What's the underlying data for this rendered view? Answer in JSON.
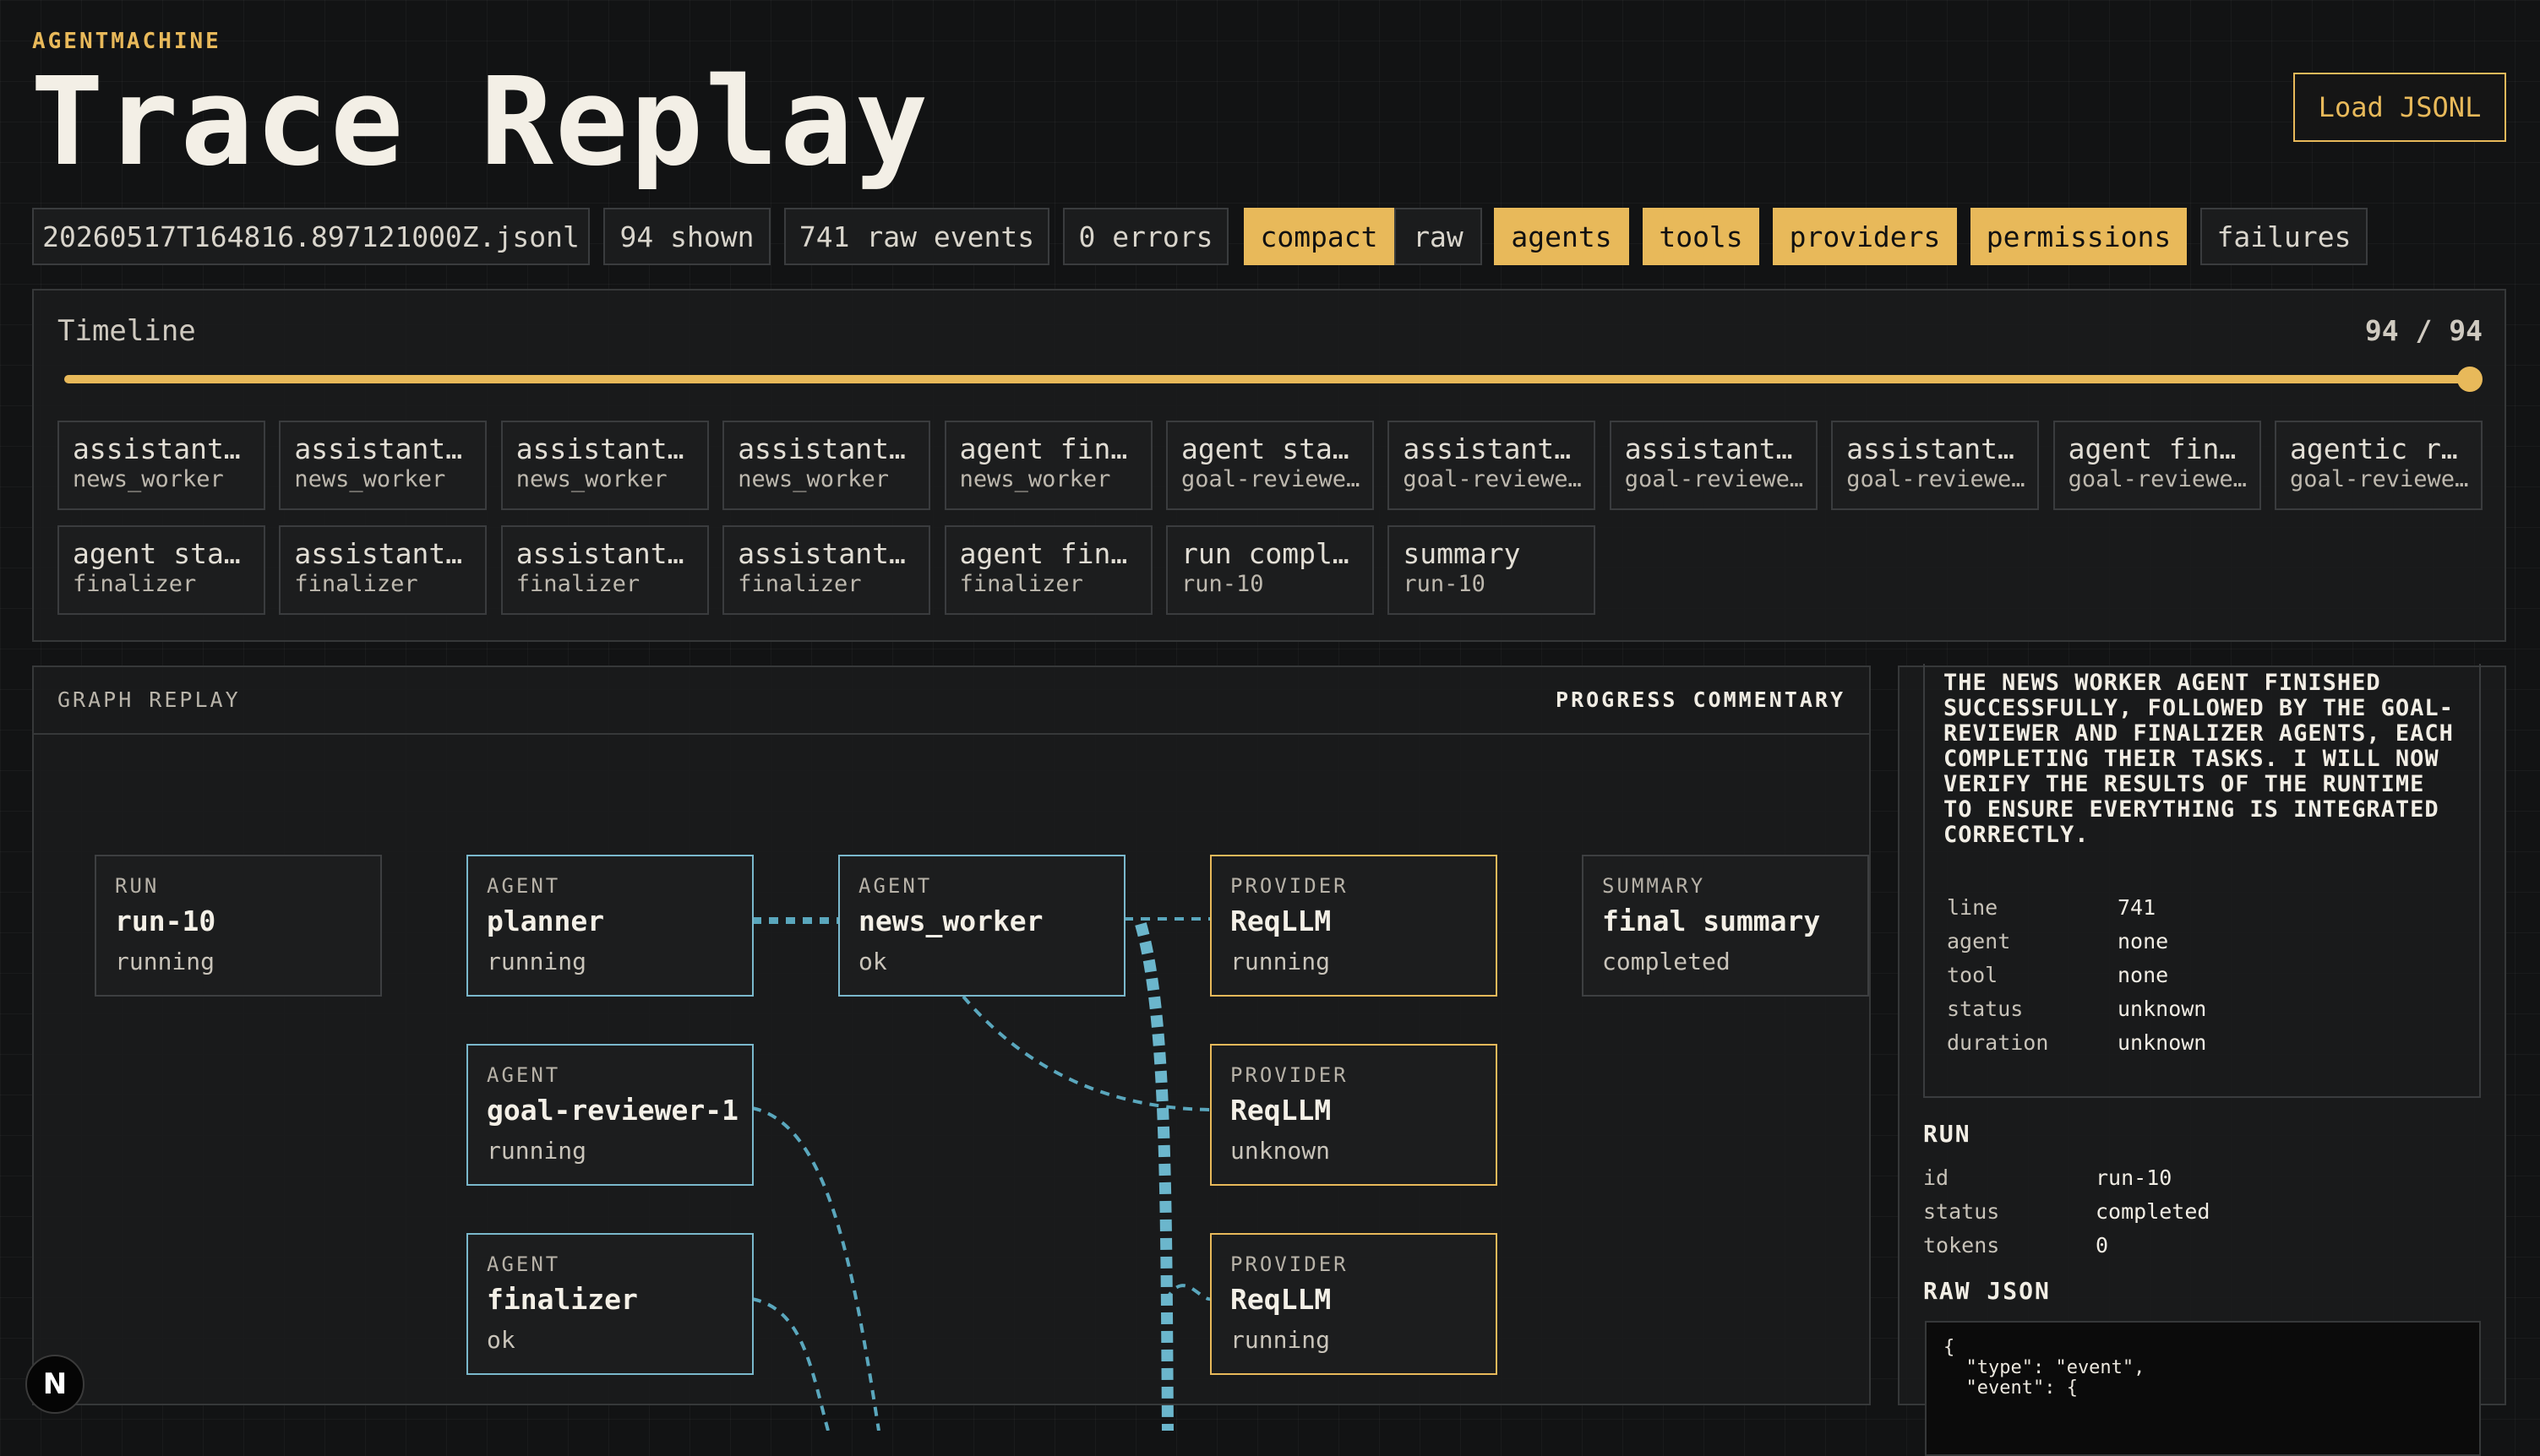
{
  "header": {
    "brand": "AGENTMACHINE",
    "title": "Trace Replay",
    "load_button": "Load JSONL"
  },
  "toolbar": {
    "file": "20260517T164816.897121000Z.jsonl",
    "shown": "94 shown",
    "raw_events": "741 raw events",
    "errors": "0 errors",
    "view_modes": [
      "compact",
      "raw"
    ],
    "active_view": "compact",
    "filters": [
      {
        "label": "agents",
        "active": true
      },
      {
        "label": "tools",
        "active": true
      },
      {
        "label": "providers",
        "active": true
      },
      {
        "label": "permissions",
        "active": true
      },
      {
        "label": "failures",
        "active": false
      }
    ]
  },
  "timeline": {
    "label": "Timeline",
    "position": "94 / 94",
    "progress": 1.0,
    "events": [
      {
        "title": "assistant…",
        "sub": "news_worker"
      },
      {
        "title": "assistant…",
        "sub": "news_worker"
      },
      {
        "title": "assistant…",
        "sub": "news_worker"
      },
      {
        "title": "assistant…",
        "sub": "news_worker"
      },
      {
        "title": "agent fin…",
        "sub": "news_worker"
      },
      {
        "title": "agent sta…",
        "sub": "goal-reviewe…"
      },
      {
        "title": "assistant…",
        "sub": "goal-reviewe…"
      },
      {
        "title": "assistant…",
        "sub": "goal-reviewe…"
      },
      {
        "title": "assistant…",
        "sub": "goal-reviewe…"
      },
      {
        "title": "agent fin…",
        "sub": "goal-reviewe…"
      },
      {
        "title": "agentic r…",
        "sub": "goal-reviewe…"
      },
      {
        "title": "agent sta…",
        "sub": "finalizer"
      },
      {
        "title": "assistant…",
        "sub": "finalizer"
      },
      {
        "title": "assistant…",
        "sub": "finalizer"
      },
      {
        "title": "assistant…",
        "sub": "finalizer"
      },
      {
        "title": "agent fin…",
        "sub": "finalizer"
      },
      {
        "title": "run compl…",
        "sub": "run-10"
      },
      {
        "title": "summary",
        "sub": "run-10"
      }
    ]
  },
  "graph": {
    "heading": "GRAPH REPLAY",
    "commentary_heading": "PROGRESS COMMENTARY",
    "nodes": [
      {
        "kind": "RUN",
        "name": "run-10",
        "status": "running",
        "type": "run"
      },
      {
        "kind": "AGENT",
        "name": "planner",
        "status": "running",
        "type": "agent"
      },
      {
        "kind": "AGENT",
        "name": "news_worker",
        "status": "ok",
        "type": "agent"
      },
      {
        "kind": "PROVIDER",
        "name": "ReqLLM",
        "status": "running",
        "type": "provider"
      },
      {
        "kind": "SUMMARY",
        "name": "final summary",
        "status": "completed",
        "type": "summary"
      },
      {
        "kind": "AGENT",
        "name": "goal-reviewer-1",
        "status": "running",
        "type": "agent"
      },
      {
        "kind": "PROVIDER",
        "name": "ReqLLM",
        "status": "unknown",
        "type": "provider"
      },
      {
        "kind": "AGENT",
        "name": "finalizer",
        "status": "ok",
        "type": "agent"
      },
      {
        "kind": "PROVIDER",
        "name": "ReqLLM",
        "status": "running",
        "type": "provider"
      }
    ]
  },
  "sidebar": {
    "commentary": "THE NEWS WORKER AGENT FINISHED SUCCESSFULLY, FOLLOWED BY THE GOAL-REVIEWER AND FINALIZER AGENTS, EACH COMPLETING THEIR TASKS. I WILL NOW VERIFY THE RESULTS OF THE RUNTIME TO ENSURE EVERYTHING IS INTEGRATED CORRECTLY.",
    "event_details": [
      {
        "key": "line",
        "value": "741"
      },
      {
        "key": "agent",
        "value": "none"
      },
      {
        "key": "tool",
        "value": "none"
      },
      {
        "key": "status",
        "value": "unknown"
      },
      {
        "key": "duration",
        "value": "unknown"
      }
    ],
    "run_heading": "RUN",
    "run_details": [
      {
        "key": "id",
        "value": "run-10"
      },
      {
        "key": "status",
        "value": "completed"
      },
      {
        "key": "tokens",
        "value": "0"
      }
    ],
    "raw_json_heading": "RAW JSON",
    "raw_json": "{\n  \"type\": \"event\",\n  \"event\": {"
  },
  "misc": {
    "framework_badge": "N"
  },
  "colors": {
    "accent": "#e8b95a",
    "agent_border": "#7ab8cc",
    "edge": "#5aa7bd",
    "background": "#121314"
  }
}
